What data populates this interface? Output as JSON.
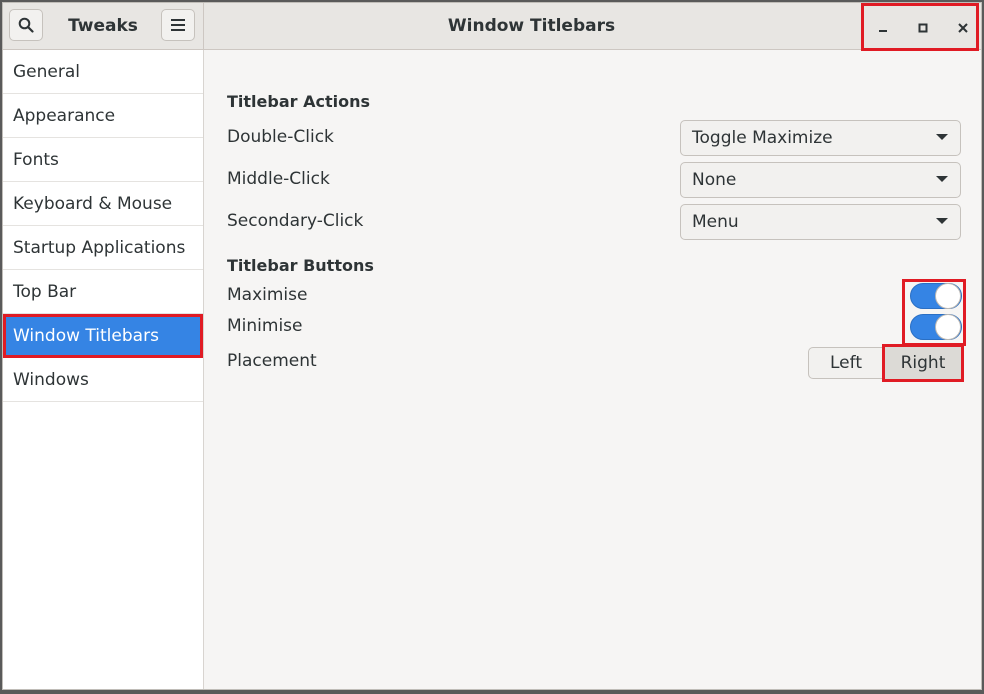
{
  "header": {
    "app_title": "Tweaks",
    "page_title": "Window Titlebars"
  },
  "sidebar": {
    "items": [
      {
        "label": "General"
      },
      {
        "label": "Appearance"
      },
      {
        "label": "Fonts"
      },
      {
        "label": "Keyboard & Mouse"
      },
      {
        "label": "Startup Applications"
      },
      {
        "label": "Top Bar"
      },
      {
        "label": "Window Titlebars",
        "selected": true
      },
      {
        "label": "Windows"
      }
    ]
  },
  "titlebar_actions": {
    "title": "Titlebar Actions",
    "double_click": {
      "label": "Double-Click",
      "value": "Toggle Maximize"
    },
    "middle_click": {
      "label": "Middle-Click",
      "value": "None"
    },
    "secondary_click": {
      "label": "Secondary-Click",
      "value": "Menu"
    }
  },
  "titlebar_buttons": {
    "title": "Titlebar Buttons",
    "maximise": {
      "label": "Maximise",
      "enabled": true
    },
    "minimise": {
      "label": "Minimise",
      "enabled": true
    },
    "placement": {
      "label": "Placement",
      "options": [
        "Left",
        "Right"
      ],
      "selected": "Right"
    }
  },
  "colors": {
    "accent": "#3584e4",
    "highlight": "#e01b24"
  }
}
